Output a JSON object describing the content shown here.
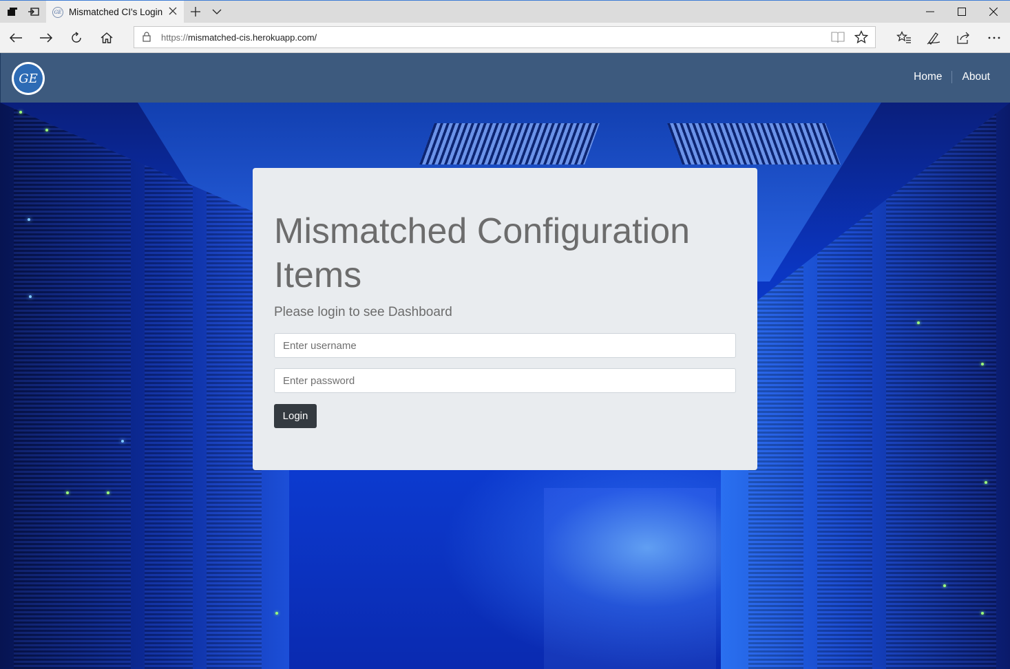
{
  "browser": {
    "tab_title": "Mismatched CI's Login",
    "url_protocol": "https://",
    "url_host": "mismatched-cis.herokuapp.com/"
  },
  "site": {
    "logo_text": "GE",
    "nav": [
      {
        "label": "Home"
      },
      {
        "label": "About"
      }
    ]
  },
  "login": {
    "heading": "Mismatched Configuration Items",
    "subheading": "Please login to see Dashboard",
    "username_placeholder": "Enter username",
    "password_placeholder": "Enter password",
    "submit_label": "Login"
  },
  "colors": {
    "header_bg": "#3d5a7e",
    "card_bg": "#e9ecef",
    "button_bg": "#343a40"
  }
}
